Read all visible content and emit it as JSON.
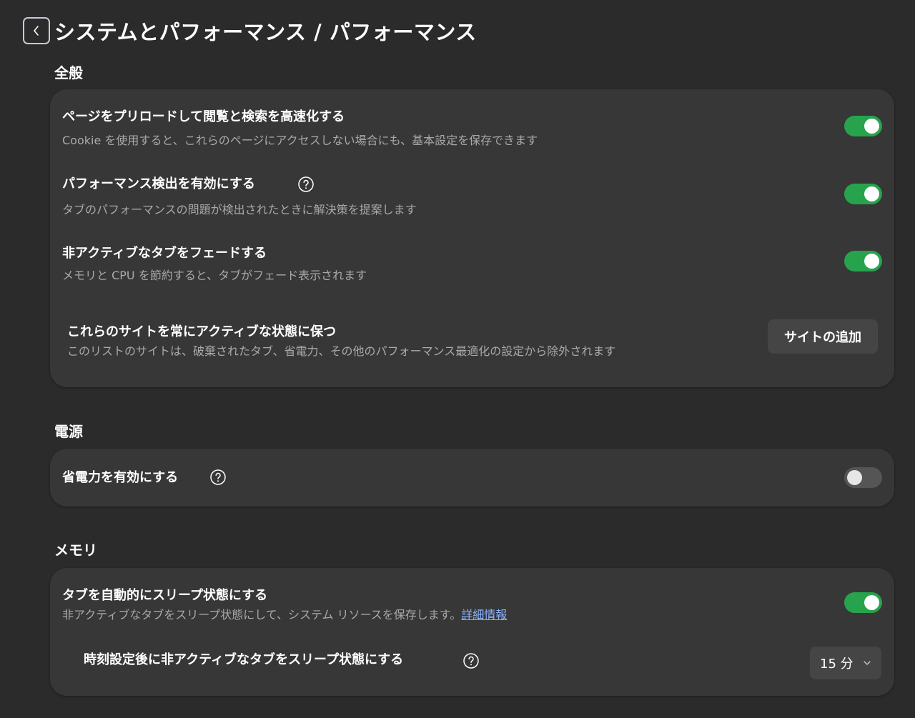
{
  "header": {
    "title": "システムとパフォーマンス / パフォーマンス",
    "back_icon": "chevron-left-icon"
  },
  "sections": {
    "general": {
      "title": "全般",
      "preload": {
        "title": "ページをプリロードして閲覧と検索を高速化する",
        "desc": "Cookie を使用すると、これらのページにアクセスしない場合にも、基本設定を保存できます",
        "enabled": true
      },
      "perf_detect": {
        "title": "パフォーマンス検出を有効にする",
        "desc": "タブのパフォーマンスの問題が検出されたときに解決策を提案します",
        "enabled": true
      },
      "fade_tabs": {
        "title": "非アクティブなタブをフェードする",
        "desc": "メモリと CPU を節約すると、タブがフェード表示されます",
        "enabled": true
      },
      "always_active": {
        "title": "これらのサイトを常にアクティブな状態に保つ",
        "desc": "このリストのサイトは、破棄されたタブ、省電力、その他のパフォーマンス最適化の設定から除外されます",
        "button_label": "サイトの追加"
      }
    },
    "power": {
      "title": "電源",
      "power_saver": {
        "title": "省電力を有効にする",
        "enabled": false
      }
    },
    "memory": {
      "title": "メモリ",
      "sleeping_tabs": {
        "title": "タブを自動的にスリープ状態にする",
        "desc": "非アクティブなタブをスリープ状態にして、システム リソースを保存します。",
        "link_label": "詳細情報",
        "enabled": true
      },
      "sleep_after": {
        "title": "時刻設定後に非アクティブなタブをスリープ状態にする",
        "selected": "15 分"
      }
    }
  },
  "colors": {
    "background": "#2b2b2b",
    "card": "#373737",
    "toggle_on": "#27a34d",
    "link": "#8bb4ff"
  }
}
